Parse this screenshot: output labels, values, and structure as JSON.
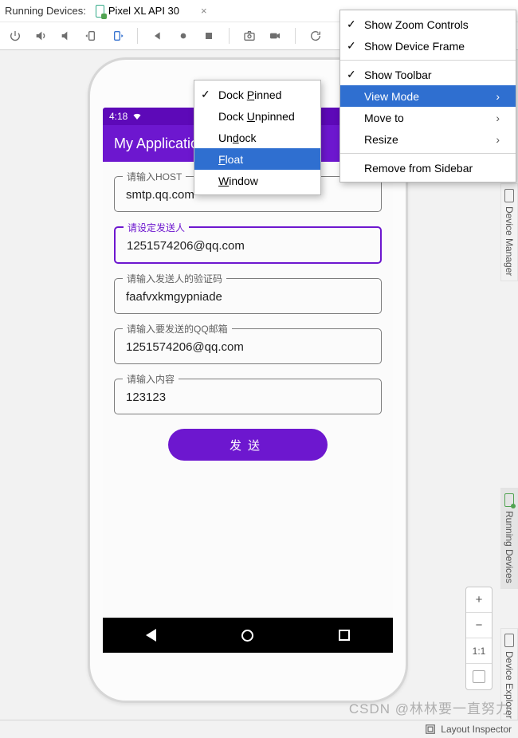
{
  "header": {
    "running_label": "Running Devices:",
    "device_name": "Pixel XL API 30"
  },
  "toolbar_icons": [
    "power",
    "volume-up",
    "volume-down",
    "rotate-left",
    "rotate-right",
    "back",
    "home",
    "overview",
    "screenshot",
    "record",
    "reload",
    "more"
  ],
  "phone": {
    "time": "4:18",
    "app_title": "My Application",
    "fields": [
      {
        "label": "请输入HOST",
        "value": "smtp.qq.com",
        "focused": false
      },
      {
        "label": "请设定发送人",
        "value": "1251574206@qq.com",
        "focused": true
      },
      {
        "label": "请输入发送人的验证码",
        "value": "faafvxkmgypniade",
        "focused": false
      },
      {
        "label": "请输入要发送的QQ邮箱",
        "value": "1251574206@qq.com",
        "focused": false
      },
      {
        "label": "请输入内容",
        "value": "123123",
        "focused": false
      }
    ],
    "send_label": "发送"
  },
  "submenu": {
    "items": [
      {
        "label_pre": "Dock ",
        "ul": "P",
        "label_post": "inned",
        "checked": true,
        "selected": false
      },
      {
        "label_pre": "Dock ",
        "ul": "U",
        "label_post": "npinned",
        "checked": false,
        "selected": false
      },
      {
        "label_pre": "Un",
        "ul": "d",
        "label_post": "ock",
        "checked": false,
        "selected": false
      },
      {
        "label_pre": "",
        "ul": "F",
        "label_post": "loat",
        "checked": false,
        "selected": true
      },
      {
        "label_pre": "",
        "ul": "W",
        "label_post": "indow",
        "checked": false,
        "selected": false
      }
    ]
  },
  "mainmenu": {
    "items": [
      {
        "label": "Show Zoom Controls",
        "checked": true,
        "arrow": false,
        "selected": false
      },
      {
        "label": "Show Device Frame",
        "checked": true,
        "arrow": false,
        "selected": false
      },
      {
        "sep": true
      },
      {
        "label": "Show Toolbar",
        "checked": true,
        "arrow": false,
        "selected": false
      },
      {
        "label": "View Mode",
        "checked": false,
        "arrow": true,
        "selected": true
      },
      {
        "label": "Move to",
        "checked": false,
        "arrow": true,
        "selected": false
      },
      {
        "label": "Resize",
        "checked": false,
        "arrow": true,
        "selected": false
      },
      {
        "sep": true
      },
      {
        "label": "Remove from Sidebar",
        "checked": false,
        "arrow": false,
        "selected": false
      }
    ]
  },
  "sidetabs": {
    "t1": "Device Manager",
    "t2": "Running Devices",
    "t3": "Device Explorer"
  },
  "zoom": {
    "plus": "+",
    "minus": "−",
    "ratio": "1:1"
  },
  "bottom": {
    "label": "Layout Inspector"
  },
  "watermark": "CSDN @林林要一直努力"
}
